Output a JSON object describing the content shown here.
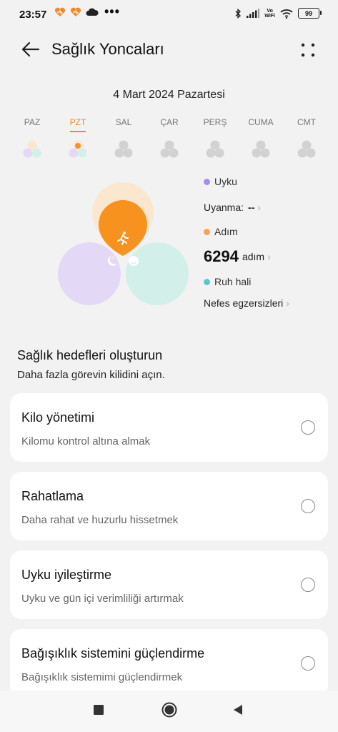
{
  "status_bar": {
    "time": "23:57",
    "more": "•••",
    "vowifi_top": "Vo",
    "vowifi_bottom": "WiFi",
    "battery": "99",
    "icons": [
      "heart-app-icon",
      "heart-app-icon",
      "cloud-icon",
      "bluetooth-icon",
      "signal-icon",
      "wifi-icon",
      "battery-icon"
    ]
  },
  "header": {
    "title": "Sağlık Yoncaları",
    "back_icon": "arrow-left-icon",
    "more_icon": "dots-grid-icon"
  },
  "date": "4 Mart 2024 Pazartesi",
  "week": [
    {
      "label": "PAZ",
      "active": false,
      "colored": true
    },
    {
      "label": "PZT",
      "active": true,
      "colored": true
    },
    {
      "label": "SAL",
      "active": false,
      "colored": false
    },
    {
      "label": "ÇAR",
      "active": false,
      "colored": false
    },
    {
      "label": "PERŞ",
      "active": false,
      "colored": false
    },
    {
      "label": "CUMA",
      "active": false,
      "colored": false
    },
    {
      "label": "CMT",
      "active": false,
      "colored": false
    }
  ],
  "legend": {
    "sleep": {
      "label": "Uyku",
      "color": "#a98be8",
      "sub_label": "Uyanma:",
      "sub_value": "--"
    },
    "steps": {
      "label": "Adım",
      "color": "#f5a35a",
      "value": "6294",
      "unit": "adım"
    },
    "mood": {
      "label": "Ruh hali",
      "color": "#5bc8c8",
      "sub_label": "Nefes egzersizleri"
    }
  },
  "colors": {
    "accent": "#f0892a",
    "sleep_petal": "#e3d9f6",
    "steps_petal_bg": "#fbe6cf",
    "steps_petal_fill": "#f7921e",
    "mood_petal": "#d3efea"
  },
  "goals": {
    "title": "Sağlık hedefleri oluşturun",
    "subtitle": "Daha fazla görevin kilidini açın.",
    "items": [
      {
        "title": "Kilo yönetimi",
        "desc": "Kilomu kontrol altına almak"
      },
      {
        "title": "Rahatlama",
        "desc": "Daha rahat ve huzurlu hissetmek"
      },
      {
        "title": "Uyku iyileştirme",
        "desc": "Uyku ve gün içi verimliliği artırmak"
      },
      {
        "title": "Bağışıklık sistemini güçlendirme",
        "desc": "Bağışıklık sistemimi güçlendirmek"
      }
    ]
  },
  "nav": [
    "recents-square-icon",
    "home-circle-icon",
    "back-triangle-icon"
  ]
}
